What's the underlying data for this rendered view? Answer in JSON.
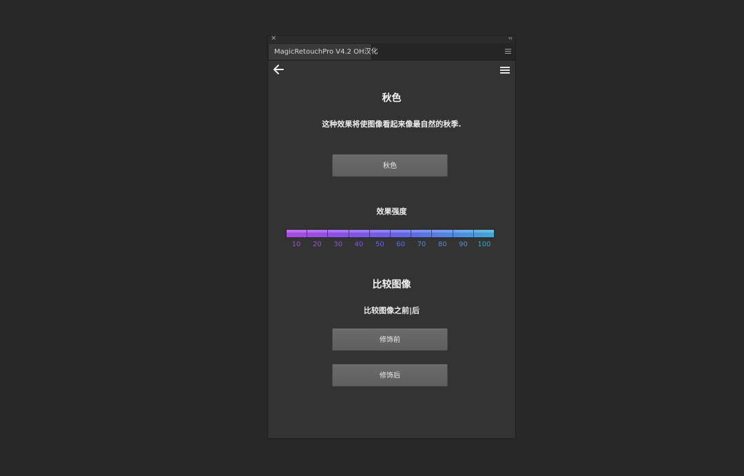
{
  "panel": {
    "close_glyph": "×",
    "collapse_glyph": "‹‹",
    "tab_title": "MagicRetouchPro V4.2 OH汉化",
    "icons": {
      "back": "arrow-left-icon",
      "menu": "hamburger-menu-icon",
      "tab_menu": "panel-menu-icon"
    }
  },
  "effect": {
    "title": "秋色",
    "description": "这种效果将使图像看起来像最自然的秋季.",
    "apply_label": "秋色"
  },
  "strength": {
    "label": "效果强度",
    "ticks": [
      "10",
      "20",
      "30",
      "40",
      "50",
      "60",
      "70",
      "80",
      "90",
      "100"
    ],
    "colors": [
      "#a64ad9",
      "#9a4ed8",
      "#8a55da",
      "#7b5bdc",
      "#6d63de",
      "#6070dc",
      "#5580d6",
      "#4c8fd0",
      "#4598c9",
      "#3ea3c2"
    ]
  },
  "compare": {
    "title": "比较图像",
    "subtitle": "比较图像之前|后",
    "before_label": "修饰前",
    "after_label": "修饰后"
  }
}
